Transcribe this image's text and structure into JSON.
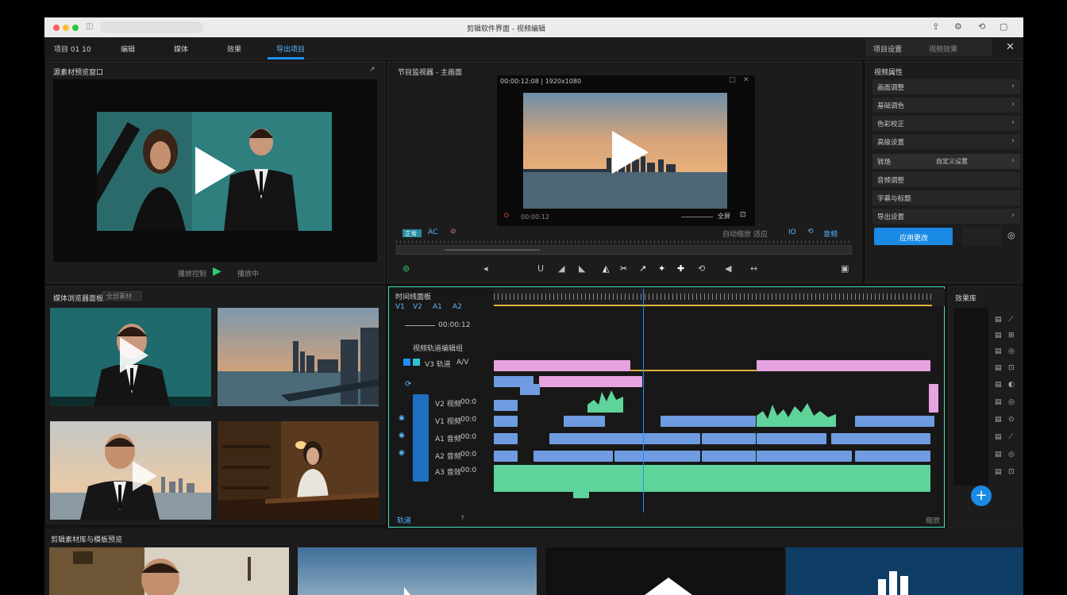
{
  "window": {
    "title": "剪辑软件界面 - 视频编辑"
  },
  "menu": {
    "items": [
      "项目 01 10",
      "编辑",
      "媒体",
      "效果",
      "导出项目"
    ],
    "active_index": 4,
    "right_tabs": [
      "项目设置",
      "视频效果"
    ]
  },
  "source_panel": {
    "title": "源素材预览窗口",
    "expand_label": "↗",
    "left_label": "播放控制",
    "right_label": "播放中"
  },
  "program_panel": {
    "title": "节目监视器 - 主画面",
    "top_bar_text": "00:00:12:08 | 1920x1080",
    "time_text": "00:00:12",
    "quality_label": "全屏",
    "toolbar_left": [
      "正常",
      "AC",
      "⊘"
    ],
    "toolbar_right": [
      "自动缩放",
      "适应",
      "IO",
      "⟲",
      "音频"
    ],
    "tools": [
      "⊚",
      "◂",
      "U",
      "◢",
      "◣",
      "◭",
      "✂",
      "↗",
      "✦",
      "✚",
      "⟲",
      "◀",
      "↔",
      "▣"
    ]
  },
  "media_browser": {
    "title": "媒体浏览器面板",
    "filter_label": "全部素材"
  },
  "timeline": {
    "title": "时间线面板",
    "tracks_header": [
      "V1",
      "V2",
      "A1",
      "A2"
    ],
    "timecode": "00:00:12",
    "group_label": "视频轨道编辑组",
    "track_labels": [
      "V3 轨道",
      "V2 视频",
      "V1 视频",
      "A1 音频",
      "A2 音频",
      "A3 音效"
    ],
    "track_codes": [
      "A/V",
      "00:0",
      "00:0",
      "00:0",
      "00:0"
    ],
    "footer_left": "轨道",
    "footer_mid": "?",
    "footer_right": "缩放"
  },
  "effects_sidebar": {
    "title": "效果库"
  },
  "properties": {
    "header": "视频属性",
    "rows": [
      "画面调整",
      "基础调色",
      "色彩校正",
      "高级设置",
      "转场",
      "音频调整",
      "字幕与标题",
      "导出设置"
    ],
    "row_value": "自定义设置",
    "apply_button": "应用更改",
    "colors": {
      "accent": "#1e8fe6",
      "button": "#1a8ae5"
    }
  },
  "bottom_strip": {
    "title": "剪辑素材库与模板预览"
  },
  "colors": {
    "accent_blue": "#1e90ff",
    "play_green": "#2ecc71",
    "clip_blue": "#6f9ce0",
    "clip_pink": "#e6a3e0",
    "clip_green": "#5fd49a",
    "timeline_border": "#46e0c0"
  }
}
